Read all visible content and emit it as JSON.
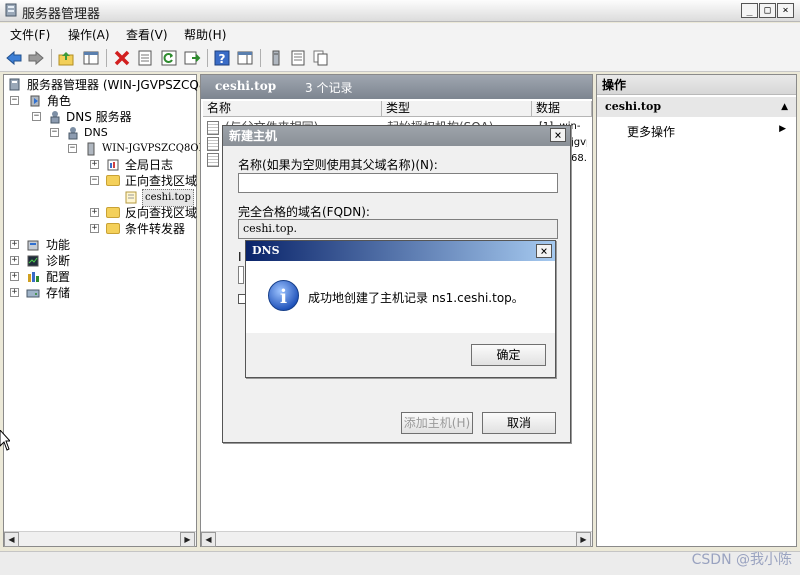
{
  "window": {
    "title": "服务器管理器",
    "min_label": "_",
    "max_label": "□",
    "close_label": "×"
  },
  "menu": [
    "文件(F)",
    "操作(A)",
    "查看(V)",
    "帮助(H)"
  ],
  "tree": {
    "root": "服务器管理器 (WIN-JGVPSZCQ80",
    "roles": "角色",
    "dns_server": "DNS 服务器",
    "dns": "DNS",
    "host": "WIN-JGVPSZCQ8OR",
    "global_log": "全局日志",
    "forward_zone": "正向查找区域",
    "zone": "ceshi.top",
    "reverse_zone": "反向查找区域",
    "cond_forwarders": "条件转发器",
    "features": "功能",
    "diagnostics": "诊断",
    "config": "配置",
    "storage": "存储"
  },
  "content": {
    "zone_name": "ceshi.top",
    "record_count": "3 个记录",
    "columns": [
      "名称",
      "类型",
      "数据"
    ],
    "rows": [
      {
        "name": "(与父文件夹相同)",
        "type": "起始授权机构(SOA)",
        "data": "[1], win-"
      },
      {
        "name": "",
        "type": "",
        "data": "jgvps"
      },
      {
        "name": "",
        "type": "",
        "data": "68.1"
      }
    ]
  },
  "actions": {
    "header": "操作",
    "section": "ceshi.top",
    "more": "更多操作",
    "collapse_arrow": "▲",
    "more_arrow": "▶"
  },
  "new_host_dialog": {
    "title": "新建主机",
    "name_label": "名称(如果为空则使用其父域名称)(N):",
    "name_value": "",
    "fqdn_label": "完全合格的域名(FQDN):",
    "fqdn_value": "ceshi.top.",
    "ip_label_partial": "I",
    "add_button": "添加主机(H)",
    "cancel_button": "取消"
  },
  "dns_dialog": {
    "title": "DNS",
    "message": "成功地创建了主机记录 ns1.ceshi.top。",
    "ok_button": "确定",
    "info_glyph": "i"
  },
  "watermark": "CSDN @我小陈"
}
